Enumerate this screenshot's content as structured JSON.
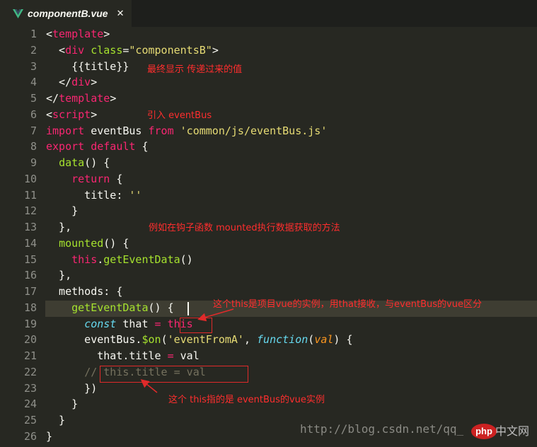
{
  "tab": {
    "filename": "componentB.vue",
    "close_glyph": "✕",
    "icon": "vue-logo-icon",
    "icon_color": "#41b883"
  },
  "gutter": [
    "1",
    "2",
    "3",
    "4",
    "5",
    "6",
    "7",
    "8",
    "9",
    "10",
    "11",
    "12",
    "13",
    "14",
    "15",
    "16",
    "17",
    "18",
    "19",
    "20",
    "21",
    "22",
    "23",
    "24",
    "25",
    "26"
  ],
  "code": [
    [
      {
        "c": "plain",
        "t": "<"
      },
      {
        "c": "tag",
        "t": "template"
      },
      {
        "c": "plain",
        "t": ">"
      }
    ],
    [
      {
        "c": "plain",
        "t": "  <"
      },
      {
        "c": "tag",
        "t": "div"
      },
      {
        "c": "plain",
        "t": " "
      },
      {
        "c": "attr",
        "t": "class"
      },
      {
        "c": "plain",
        "t": "="
      },
      {
        "c": "str",
        "t": "\"componentsB\""
      },
      {
        "c": "plain",
        "t": ">"
      }
    ],
    [
      {
        "c": "plain",
        "t": "    {{title}}"
      }
    ],
    [
      {
        "c": "plain",
        "t": "  </"
      },
      {
        "c": "tag",
        "t": "div"
      },
      {
        "c": "plain",
        "t": ">"
      }
    ],
    [
      {
        "c": "plain",
        "t": "</"
      },
      {
        "c": "tag",
        "t": "template"
      },
      {
        "c": "plain",
        "t": ">"
      }
    ],
    [
      {
        "c": "plain",
        "t": "<"
      },
      {
        "c": "tag",
        "t": "script"
      },
      {
        "c": "plain",
        "t": ">"
      }
    ],
    [
      {
        "c": "kw",
        "t": "import"
      },
      {
        "c": "plain",
        "t": " eventBus "
      },
      {
        "c": "kw",
        "t": "from"
      },
      {
        "c": "plain",
        "t": " "
      },
      {
        "c": "str",
        "t": "'common/js/eventBus.js'"
      }
    ],
    [
      {
        "c": "kw",
        "t": "export"
      },
      {
        "c": "plain",
        "t": " "
      },
      {
        "c": "kw",
        "t": "default"
      },
      {
        "c": "plain",
        "t": " {"
      }
    ],
    [
      {
        "c": "plain",
        "t": "  "
      },
      {
        "c": "fn",
        "t": "data"
      },
      {
        "c": "plain",
        "t": "() {"
      }
    ],
    [
      {
        "c": "plain",
        "t": "    "
      },
      {
        "c": "kw",
        "t": "return"
      },
      {
        "c": "plain",
        "t": " {"
      }
    ],
    [
      {
        "c": "plain",
        "t": "      title: "
      },
      {
        "c": "str",
        "t": "''"
      }
    ],
    [
      {
        "c": "plain",
        "t": "    }"
      }
    ],
    [
      {
        "c": "plain",
        "t": "  },"
      }
    ],
    [
      {
        "c": "plain",
        "t": "  "
      },
      {
        "c": "fn",
        "t": "mounted"
      },
      {
        "c": "plain",
        "t": "() {"
      }
    ],
    [
      {
        "c": "plain",
        "t": "    "
      },
      {
        "c": "kw",
        "t": "this"
      },
      {
        "c": "plain",
        "t": "."
      },
      {
        "c": "fn",
        "t": "getEventData"
      },
      {
        "c": "plain",
        "t": "()"
      }
    ],
    [
      {
        "c": "plain",
        "t": "  },"
      }
    ],
    [
      {
        "c": "plain",
        "t": "  methods: {"
      }
    ],
    [
      {
        "c": "plain",
        "t": "    "
      },
      {
        "c": "fn",
        "t": "getEventData"
      },
      {
        "c": "plain",
        "t": "() {"
      }
    ],
    [
      {
        "c": "plain",
        "t": "      "
      },
      {
        "c": "sto",
        "t": "const"
      },
      {
        "c": "plain",
        "t": " that "
      },
      {
        "c": "kw",
        "t": "="
      },
      {
        "c": "plain",
        "t": " "
      },
      {
        "c": "kw",
        "t": "this"
      }
    ],
    [
      {
        "c": "plain",
        "t": "      eventBus."
      },
      {
        "c": "fn",
        "t": "$on"
      },
      {
        "c": "plain",
        "t": "("
      },
      {
        "c": "str",
        "t": "'eventFromA'"
      },
      {
        "c": "plain",
        "t": ", "
      },
      {
        "c": "sto",
        "t": "function"
      },
      {
        "c": "plain",
        "t": "("
      },
      {
        "c": "param",
        "t": "val"
      },
      {
        "c": "plain",
        "t": ") {"
      }
    ],
    [
      {
        "c": "plain",
        "t": "        that.title "
      },
      {
        "c": "kw",
        "t": "="
      },
      {
        "c": "plain",
        "t": " val"
      }
    ],
    [
      {
        "c": "plain",
        "t": "      "
      },
      {
        "c": "com",
        "t": "// this.title = val"
      }
    ],
    [
      {
        "c": "plain",
        "t": "      })"
      }
    ],
    [
      {
        "c": "plain",
        "t": "    }"
      }
    ],
    [
      {
        "c": "plain",
        "t": "  }"
      }
    ],
    [
      {
        "c": "plain",
        "t": "}"
      }
    ]
  ],
  "annotations": {
    "final_display": "最终显示 传递过来的值",
    "import_eventbus": "引入 eventBus",
    "mounted_hint": "例如在钩子函数 mounted执行数据获取的方法",
    "this_is_vue": "这个this是项目vue的实例，用that接收，与eventBus的vue区分",
    "this_is_eventbus": "这个 this指的是 eventBus的vue实例"
  },
  "watermark": {
    "url": "http://blog.csdn.net/qq_",
    "php_logo": "php",
    "site": "中文网"
  }
}
